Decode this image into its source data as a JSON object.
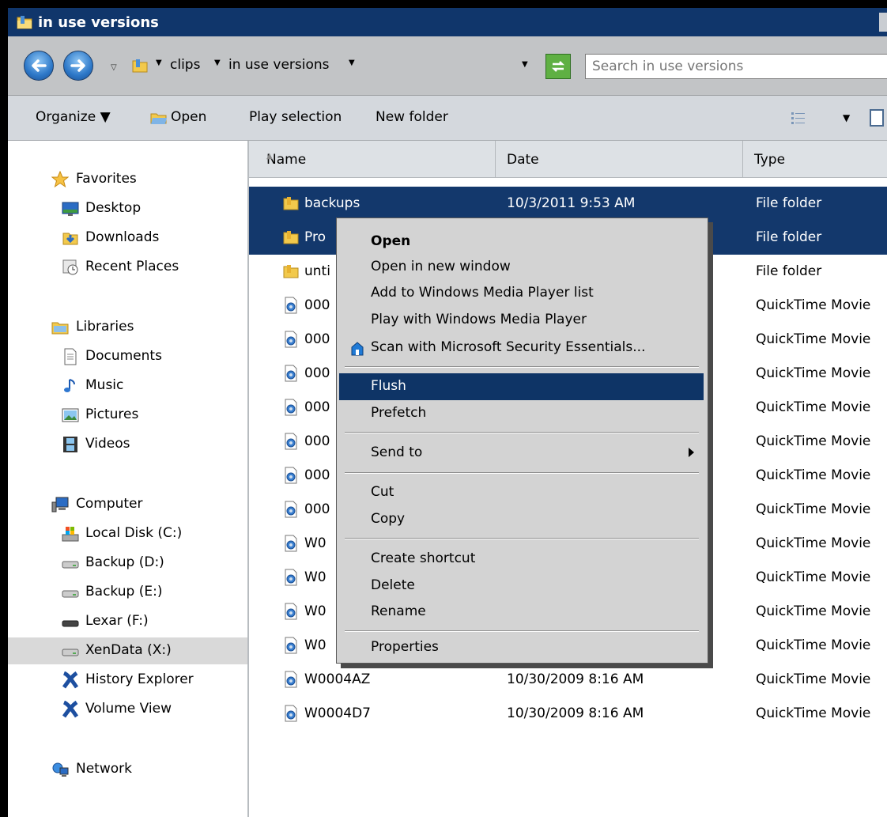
{
  "window": {
    "title": "in use versions"
  },
  "address": {
    "crumbs": [
      "clips",
      "in use versions"
    ],
    "search_placeholder": "Search in use versions"
  },
  "toolbar": {
    "organize": "Organize",
    "open": "Open",
    "play_selection": "Play selection",
    "new_folder": "New folder"
  },
  "nav": {
    "favorites": "Favorites",
    "desktop": "Desktop",
    "downloads": "Downloads",
    "recent_places": "Recent Places",
    "libraries": "Libraries",
    "documents": "Documents",
    "music": "Music",
    "pictures": "Pictures",
    "videos": "Videos",
    "computer": "Computer",
    "local_disk": "Local Disk (C:)",
    "backup_d": "Backup (D:)",
    "backup_e": "Backup (E:)",
    "lexar": "Lexar (F:)",
    "xendata": "XenData (X:)",
    "history_explorer": "History Explorer",
    "volume_view": "Volume View",
    "network": "Network"
  },
  "columns": {
    "name": "Name",
    "date": "Date",
    "type": "Type"
  },
  "files": [
    {
      "name": "backups",
      "date": "10/3/2011 9:53 AM",
      "type": "File folder"
    },
    {
      "name": "Pro",
      "date": "",
      "type": "File folder"
    },
    {
      "name": "unti",
      "date": "",
      "type": "File folder"
    },
    {
      "name": "000",
      "date": "",
      "type": "QuickTime Movie"
    },
    {
      "name": "000",
      "date": "",
      "type": "QuickTime Movie"
    },
    {
      "name": "000",
      "date": "",
      "type": "QuickTime Movie"
    },
    {
      "name": "000",
      "date": "",
      "type": "QuickTime Movie"
    },
    {
      "name": "000",
      "date": "",
      "type": "QuickTime Movie"
    },
    {
      "name": "000",
      "date": "",
      "type": "QuickTime Movie"
    },
    {
      "name": "000",
      "date": "",
      "type": "QuickTime Movie"
    },
    {
      "name": "W0",
      "date": "",
      "type": "QuickTime Movie"
    },
    {
      "name": "W0",
      "date": "",
      "type": "QuickTime Movie"
    },
    {
      "name": "W0",
      "date": "",
      "type": "QuickTime Movie"
    },
    {
      "name": "W0",
      "date": "",
      "type": "QuickTime Movie"
    },
    {
      "name": "W0004AZ",
      "date": "10/30/2009 8:16 AM",
      "type": "QuickTime Movie"
    },
    {
      "name": "W0004D7",
      "date": "10/30/2009 8:16 AM",
      "type": "QuickTime Movie"
    }
  ],
  "context_menu": {
    "open": "Open",
    "open_new_window": "Open in new window",
    "add_wmp": "Add to Windows Media Player list",
    "play_wmp": "Play with Windows Media Player",
    "scan_mse": "Scan with Microsoft Security Essentials...",
    "flush": "Flush",
    "prefetch": "Prefetch",
    "send_to": "Send to",
    "cut": "Cut",
    "copy": "Copy",
    "create_shortcut": "Create shortcut",
    "delete": "Delete",
    "rename": "Rename",
    "properties": "Properties"
  },
  "colors": {
    "title_bar": "#10366b",
    "selection": "#13386c",
    "menu_highlight": "#0e3466",
    "menu_bg": "#d3d3d3"
  }
}
